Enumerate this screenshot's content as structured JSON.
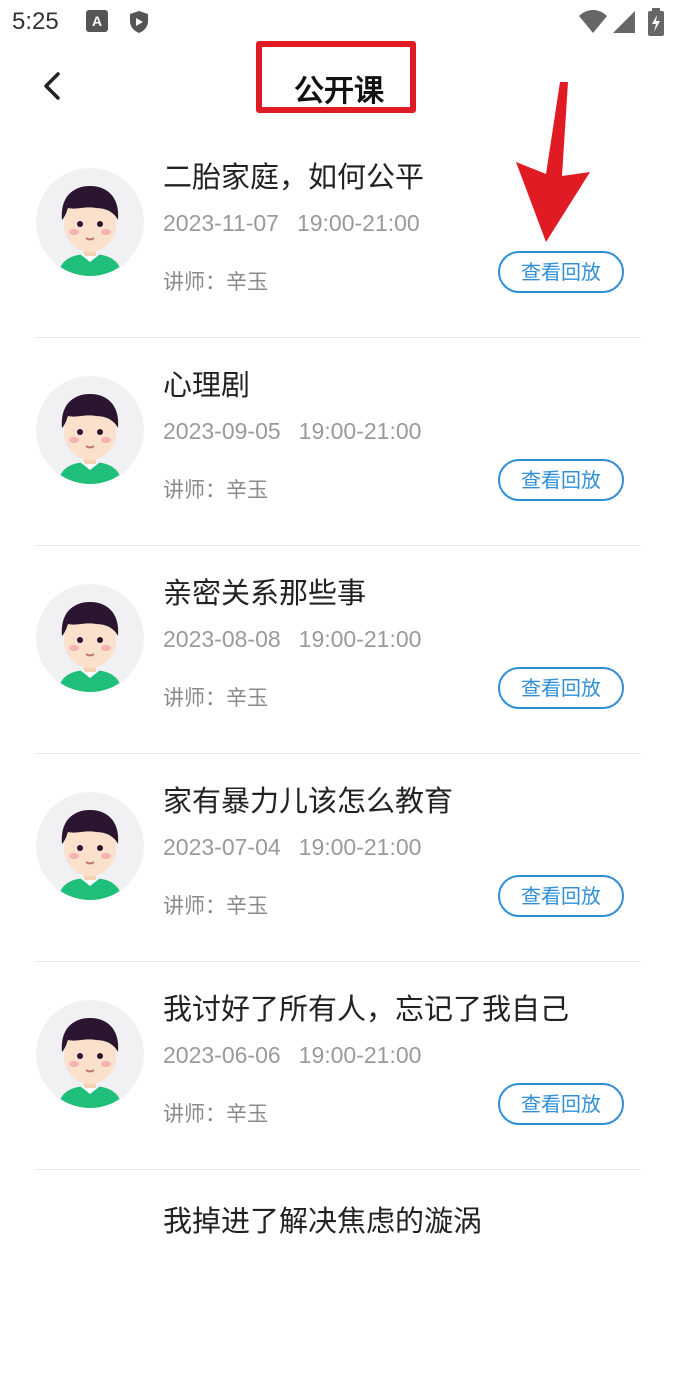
{
  "status_bar": {
    "time": "5:25",
    "a_icon": "A"
  },
  "header": {
    "title": "公开课"
  },
  "courses": [
    {
      "title": " 二胎家庭，如何公平",
      "date": "2023-11-07",
      "time": "19:00-21:00",
      "teacher": "讲师：辛玉",
      "button": "查看回放"
    },
    {
      "title": "心理剧",
      "date": "2023-09-05",
      "time": "19:00-21:00",
      "teacher": "讲师：辛玉",
      "button": "查看回放"
    },
    {
      "title": "亲密关系那些事",
      "date": "2023-08-08",
      "time": "19:00-21:00",
      "teacher": "讲师：辛玉",
      "button": "查看回放"
    },
    {
      "title": "家有暴力儿该怎么教育",
      "date": "2023-07-04",
      "time": "19:00-21:00",
      "teacher": "讲师：辛玉",
      "button": "查看回放"
    },
    {
      "title": " 我讨好了所有人，忘记了我自己",
      "date": "2023-06-06",
      "time": "19:00-21:00",
      "teacher": "讲师：辛玉",
      "button": "查看回放"
    },
    {
      "title": " 我掉进了解决焦虑的漩涡",
      "date": "",
      "time": "",
      "teacher": "",
      "button": ""
    }
  ],
  "colors": {
    "accent": "#2f8fd6",
    "annotation_red": "#e01b24"
  },
  "icons": [
    "back-arrow-icon",
    "wifi-icon",
    "signal-icon",
    "battery-icon",
    "shield-icon",
    "avatar-boy"
  ]
}
